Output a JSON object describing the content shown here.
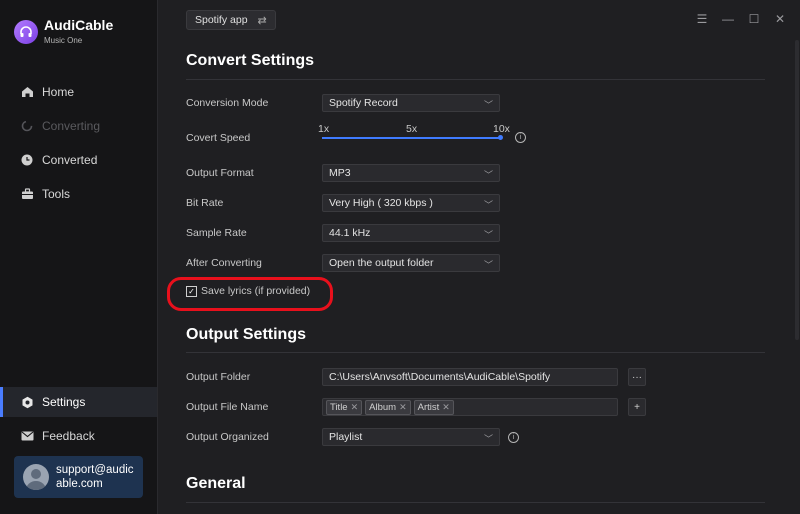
{
  "app": {
    "name": "AudiCable",
    "subtitle": "Music One"
  },
  "sidebar": {
    "items": [
      {
        "label": "Home",
        "icon": "home-icon"
      },
      {
        "label": "Converting",
        "icon": "spinner-icon"
      },
      {
        "label": "Converted",
        "icon": "clock-icon"
      },
      {
        "label": "Tools",
        "icon": "toolbox-icon"
      }
    ],
    "bottom_items": [
      {
        "label": "Settings",
        "icon": "gear-icon"
      },
      {
        "label": "Feedback",
        "icon": "mail-icon"
      }
    ],
    "account_email": "support@audicable.com"
  },
  "topbar": {
    "source": "Spotify app",
    "switch_icon": "⇄"
  },
  "convert": {
    "title": "Convert Settings",
    "conversion_mode": {
      "label": "Conversion Mode",
      "value": "Spotify Record"
    },
    "speed": {
      "label": "Covert Speed",
      "ticks": [
        "1x",
        "5x",
        "10x"
      ],
      "value_fraction": 1.0
    },
    "output_format": {
      "label": "Output Format",
      "value": "MP3"
    },
    "bit_rate": {
      "label": "Bit Rate",
      "value": "Very High ( 320 kbps )"
    },
    "sample_rate": {
      "label": "Sample Rate",
      "value": "44.1 kHz"
    },
    "after_converting": {
      "label": "After Converting",
      "value": "Open the output folder"
    },
    "save_lyrics": {
      "label": "Save lyrics (if provided)",
      "checked": true
    }
  },
  "output": {
    "title": "Output Settings",
    "folder": {
      "label": "Output Folder",
      "value": "C:\\Users\\Anvsoft\\Documents\\AudiCable\\Spotify",
      "browse": "···"
    },
    "file_name": {
      "label": "Output File Name",
      "tags": [
        "Title",
        "Album",
        "Artist"
      ],
      "add": "+"
    },
    "organized": {
      "label": "Output Organized",
      "value": "Playlist"
    }
  },
  "general": {
    "title": "General"
  },
  "colors": {
    "accent": "#3f7bff",
    "highlight": "#e8101c",
    "sidebar_bg": "#151517",
    "content_bg": "#1f1f22"
  }
}
